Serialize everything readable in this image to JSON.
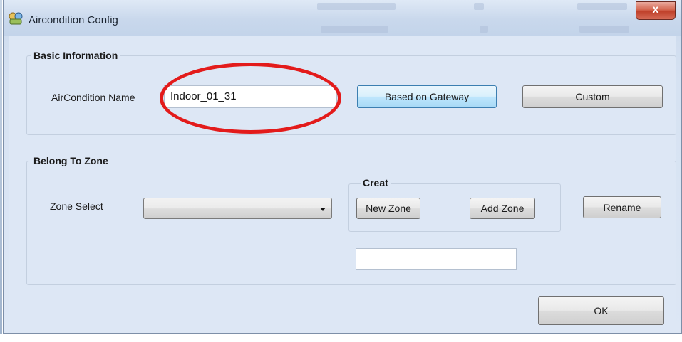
{
  "window": {
    "title": "Aircondition Config",
    "close_label": "x"
  },
  "basic_info": {
    "group_label": "Basic Information",
    "name_label": "AirCondition Name",
    "name_value": "Indoor_01_31",
    "based_on_gateway_label": "Based on Gateway",
    "custom_label": "Custom"
  },
  "zone": {
    "group_label": "Belong To Zone",
    "zone_select_label": "Zone Select",
    "zone_select_value": "",
    "creat_label": "Creat",
    "new_zone_label": "New Zone",
    "add_zone_label": "Add Zone",
    "rename_label": "Rename",
    "zone_name_value": ""
  },
  "footer": {
    "ok_label": "OK"
  },
  "annotation": {
    "color": "#e31b1b"
  },
  "icons": {
    "title": "aircondition-app-icon",
    "dropdown": "chevron-down-icon"
  }
}
